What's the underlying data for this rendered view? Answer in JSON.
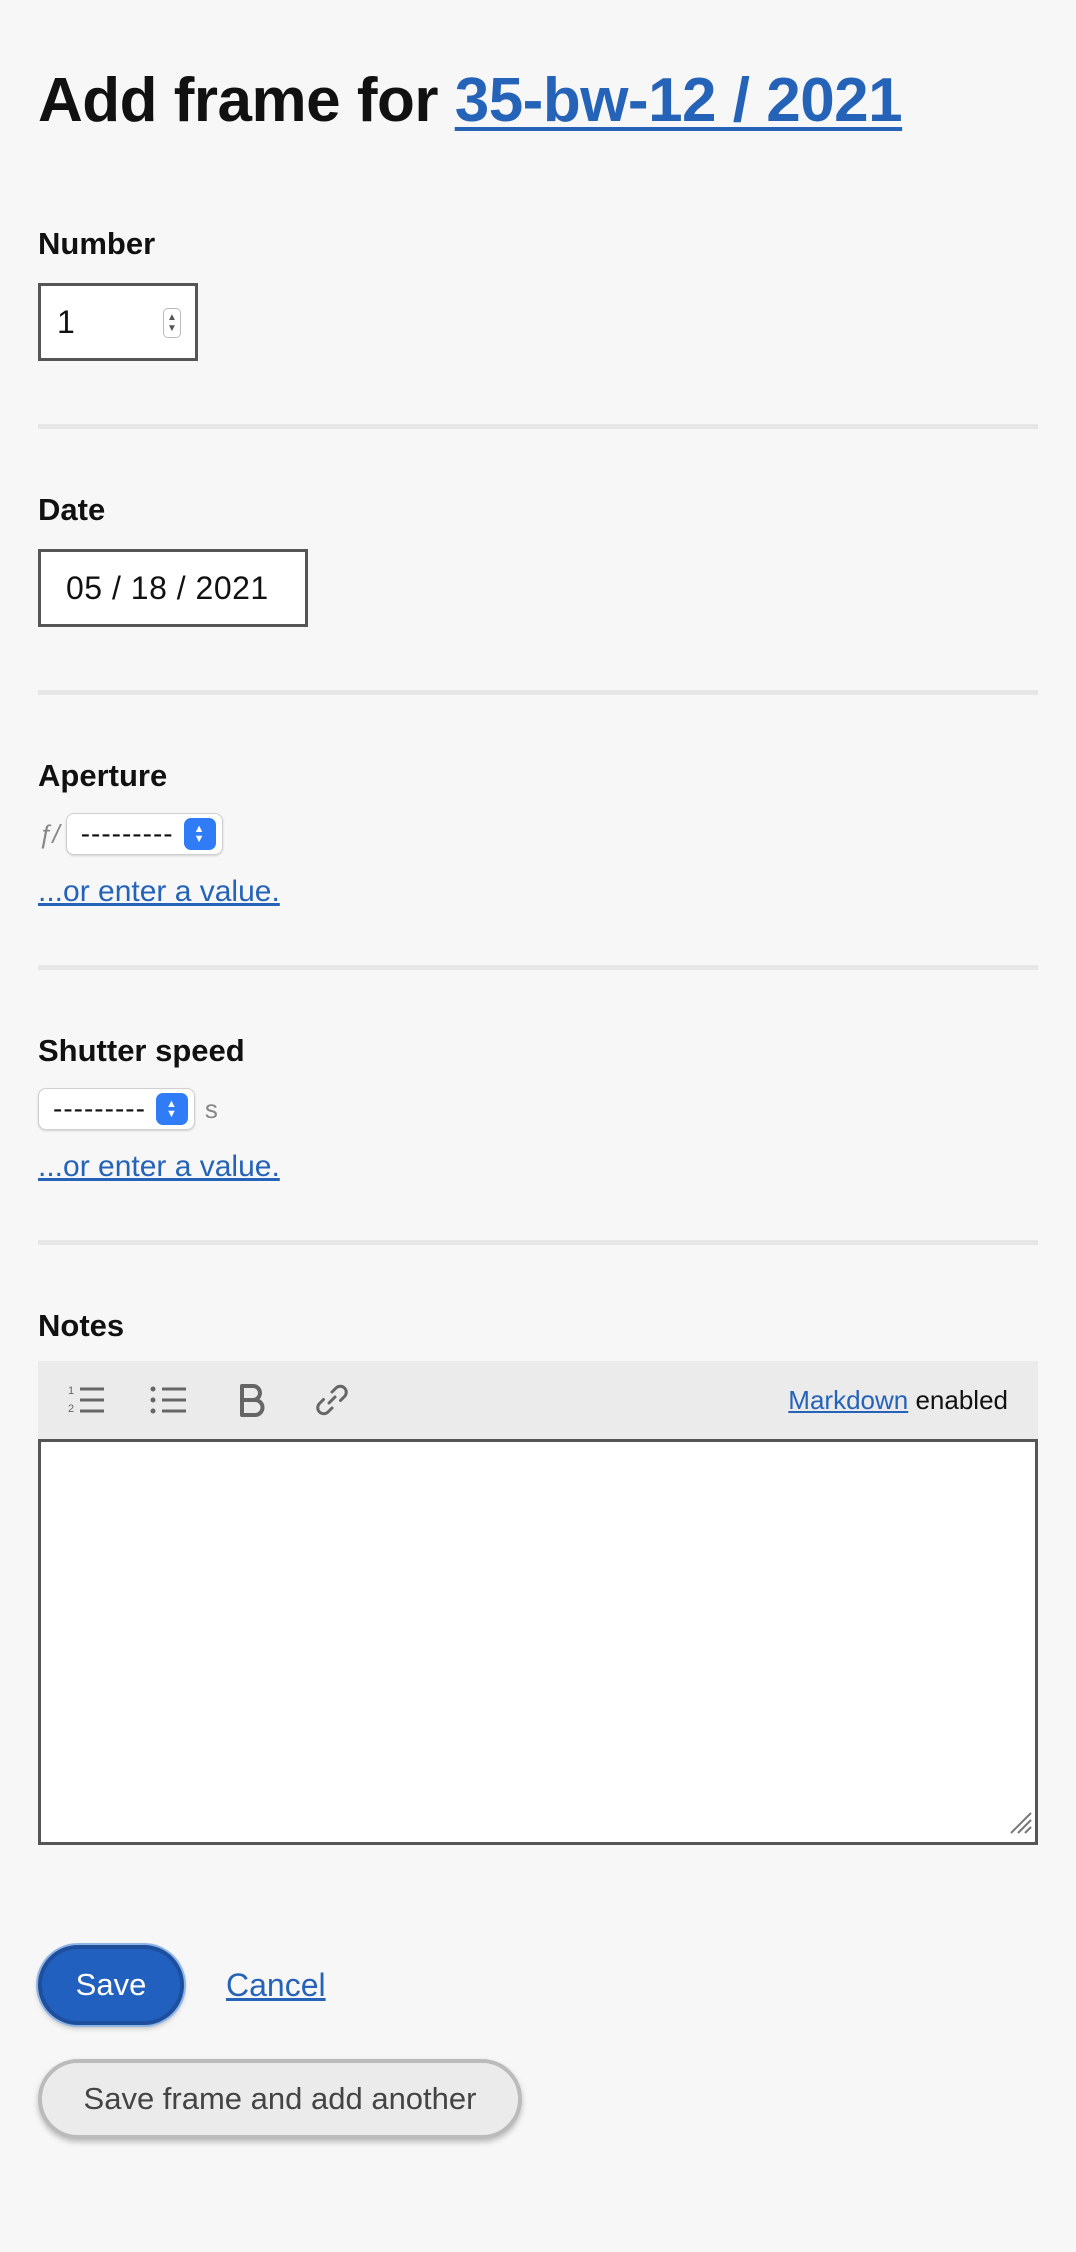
{
  "header": {
    "title_prefix": "Add frame for ",
    "title_link": "35-bw-12 / 2021"
  },
  "number": {
    "label": "Number",
    "value": "1"
  },
  "date": {
    "label": "Date",
    "value": "05 / 18 / 2021"
  },
  "aperture": {
    "label": "Aperture",
    "prefix": "ƒ/",
    "selected": "---------",
    "alt_link": "...or enter a value."
  },
  "shutter": {
    "label": "Shutter speed",
    "selected": "---------",
    "suffix": "s",
    "alt_link": "...or enter a value."
  },
  "notes": {
    "label": "Notes",
    "toolbar_link": "Markdown",
    "toolbar_text": " enabled",
    "value": ""
  },
  "actions": {
    "save_label": "Save",
    "cancel_label": "Cancel",
    "save_another_label": "Save frame and add another"
  },
  "colors": {
    "link": "#2563b8",
    "primary_button": "#2160bf",
    "select_accent": "#2f7cf6"
  }
}
